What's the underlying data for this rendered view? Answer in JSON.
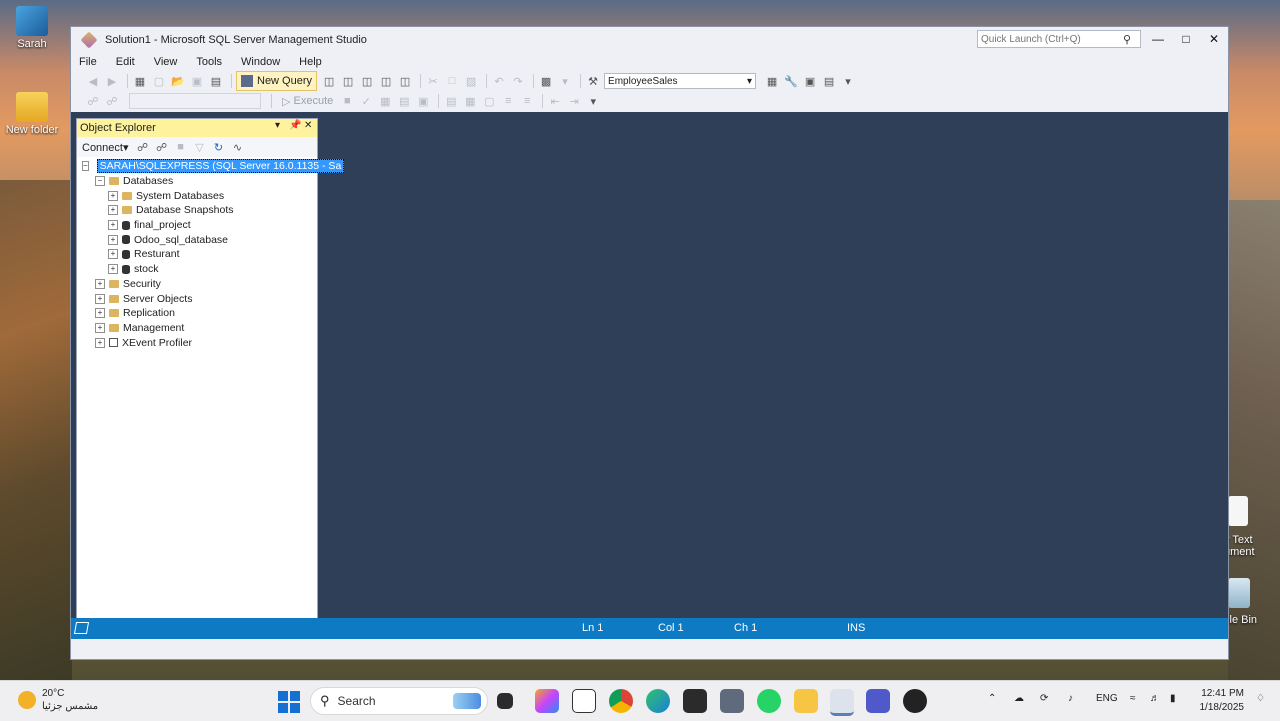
{
  "desktop": {
    "icons": [
      "Sarah",
      "New folder",
      "y Text",
      "ument",
      "cle Bin"
    ]
  },
  "window": {
    "title": "Solution1 - Microsoft SQL Server Management Studio",
    "quick_launch_placeholder": "Quick Launch (Ctrl+Q)",
    "controls": {
      "minimize": "—",
      "maximize": "□",
      "close": "✕"
    }
  },
  "menu": [
    "File",
    "Edit",
    "View",
    "Tools",
    "Window",
    "Help"
  ],
  "toolbar": {
    "new_query": "New Query",
    "database": "EmployeeSales",
    "execute": "Execute"
  },
  "object_explorer": {
    "title": "Object Explorer",
    "connect": "Connect",
    "server": "SARAH\\SQLEXPRESS (SQL Server 16.0.1135 - Sa",
    "databases_label": "Databases",
    "databases": [
      "System Databases",
      "Database Snapshots",
      "final_project",
      "Odoo_sql_database",
      "Resturant",
      "stock"
    ],
    "top_nodes": [
      "Security",
      "Server Objects",
      "Replication",
      "Management",
      "XEvent Profiler"
    ]
  },
  "status": {
    "ln": "Ln 1",
    "col": "Col 1",
    "ch": "Ch 1",
    "mode": "INS"
  },
  "taskbar": {
    "temperature": "20°C",
    "weather_desc": "مشمس جزئيا",
    "search": "Search",
    "language": "ENG",
    "time": "12:41 PM",
    "date": "1/18/2025"
  },
  "colors": {
    "accent_blue": "#0e7ac4",
    "oe_header": "#fff29d",
    "editor_bg": "#2f3f57",
    "selected": "#3399ff"
  }
}
